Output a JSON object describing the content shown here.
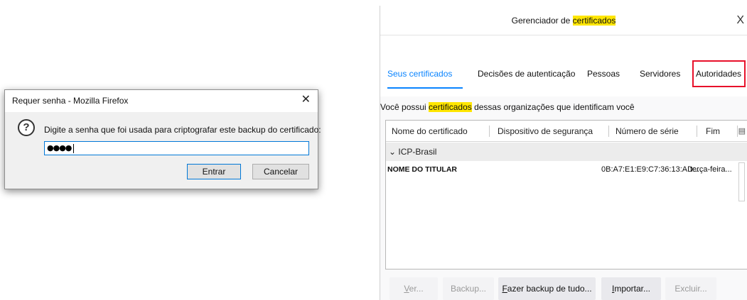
{
  "password_dialog": {
    "title": "Requer senha - Mozilla Firefox",
    "close_glyph": "✕",
    "icon": "question-icon",
    "message": "Digite a senha que foi usada para criptografar este backup do certificado:",
    "password_value": "●●●●",
    "ok_label": "Entrar",
    "cancel_label": "Cancelar"
  },
  "cert_manager": {
    "title_prefix": "Gerenciador de ",
    "title_highlight": "certificados",
    "close_glyph": "X",
    "tabs": [
      {
        "label": "Seus certificados",
        "active": true
      },
      {
        "label": "Decisões de autenticação",
        "active": false
      },
      {
        "label": "Pessoas",
        "active": false
      },
      {
        "label": "Servidores",
        "active": false
      },
      {
        "label": "Autoridades",
        "active": false,
        "outlined": true
      }
    ],
    "info_prefix": "Você possui ",
    "info_highlight": "certificados",
    "info_suffix": " dessas organizações que identificam você",
    "columns": [
      "Nome do certificado",
      "Dispositivo de segurança",
      "Número de série",
      "Fim"
    ],
    "column_picker_icon": "column-picker-icon",
    "group": {
      "expander": "⌄",
      "label": "ICP-Brasil"
    },
    "rows": [
      {
        "name": "NOME DO TITULAR",
        "device": "",
        "serial": "0B:A7:E1:E9:C7:36:13:AD:...",
        "end": "terça-feira..."
      }
    ],
    "buttons": [
      {
        "access_key": "V",
        "rest": "er...",
        "enabled": false
      },
      {
        "access_key": "",
        "rest": "Backup...",
        "enabled": false
      },
      {
        "access_key": "F",
        "rest": "azer backup de tudo...",
        "enabled": true
      },
      {
        "access_key": "I",
        "rest": "mportar...",
        "enabled": true
      },
      {
        "access_key": "",
        "rest": "Excluir...",
        "enabled": false
      }
    ]
  },
  "colors": {
    "highlight": "#ffe600",
    "active_tab": "#0a84ff",
    "outline_box": "#e8102a",
    "focus_border": "#0078d7"
  }
}
